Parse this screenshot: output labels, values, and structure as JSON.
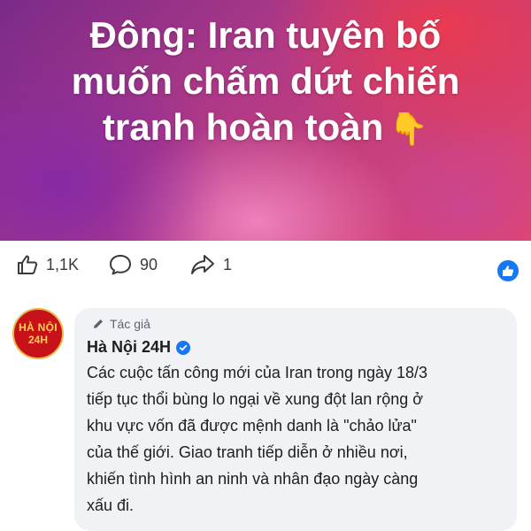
{
  "post": {
    "headline_lines": [
      "Đông: Iran tuyên bố",
      "muốn chấm dứt chiến",
      "tranh hoàn toàn"
    ],
    "headline_emoji": "👇"
  },
  "reactions": {
    "likes": "1,1K",
    "comments": "90",
    "shares": "1"
  },
  "comment": {
    "avatar_text_1": "HÀ NỘI",
    "avatar_text_2": "24H",
    "author_tag": "Tác giả",
    "author_name": "Hà Nội 24H",
    "body_lines": [
      "Các cuộc tấn công mới của Iran trong ngày 18/3",
      "tiếp tục thổi bùng lo ngại về xung đột lan rộng ở",
      "khu vực vốn đã được mệnh danh là \"chảo lửa\"",
      "của thế giới. Giao tranh tiếp diễn ở nhiều nơi,",
      "khiến tình hình an ninh và nhân đạo ngày càng",
      "xấu đi."
    ]
  },
  "colors": {
    "accent": "#1877f2",
    "bubble": "#f0f2f5"
  }
}
